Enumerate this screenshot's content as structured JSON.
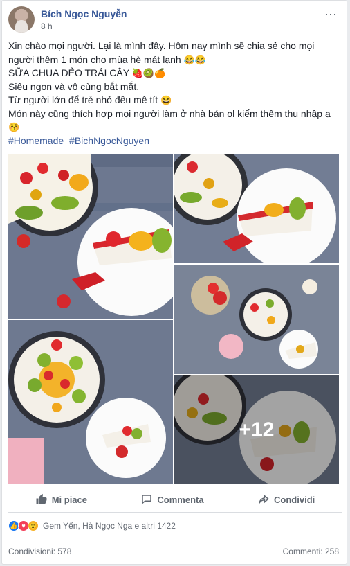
{
  "post": {
    "author": "Bích Ngọc Nguyễn",
    "time": "8 h",
    "more_icon": "more-horizontal-icon",
    "text_lines": [
      "Xin chào mọi người. Lại là mình đây. Hôm nay mình sẽ chia sẻ cho mọi",
      "người thêm 1 món cho mùa hè mát lạnh",
      "SỮA CHUA DẺO TRÁI CÂY",
      "Siêu ngon và vô cùng bắt mắt.",
      "Từ người lớn để trẻ nhỏ đều mê tít",
      "Món này cũng thích hợp mọi người làm ở nhà bán ol kiếm thêm thu nhập ạ"
    ],
    "emojis": {
      "laugh": "😂",
      "strawberry": "🍓",
      "kiwi": "🥝",
      "orange": "🍊",
      "grin": "😆",
      "blush": "😚"
    },
    "hashtags": [
      "#Homemade",
      "#BichNgocNguyen"
    ],
    "more_photos": "+12"
  },
  "actions": {
    "like": "Mi piace",
    "comment": "Commenta",
    "share": "Condividi"
  },
  "reactions": {
    "icons": [
      "like-reaction-icon",
      "love-reaction-icon",
      "wow-reaction-icon"
    ],
    "summary": "Gem Yến, Hà Ngọc Nga e altri 1422"
  },
  "stats": {
    "shares": "Condivisioni: 578",
    "comments": "Commenti: 258"
  },
  "colors": {
    "link": "#385898",
    "muted": "#616770",
    "like": "#1877f2",
    "love": "#f33e58",
    "wow": "#f7b125"
  }
}
